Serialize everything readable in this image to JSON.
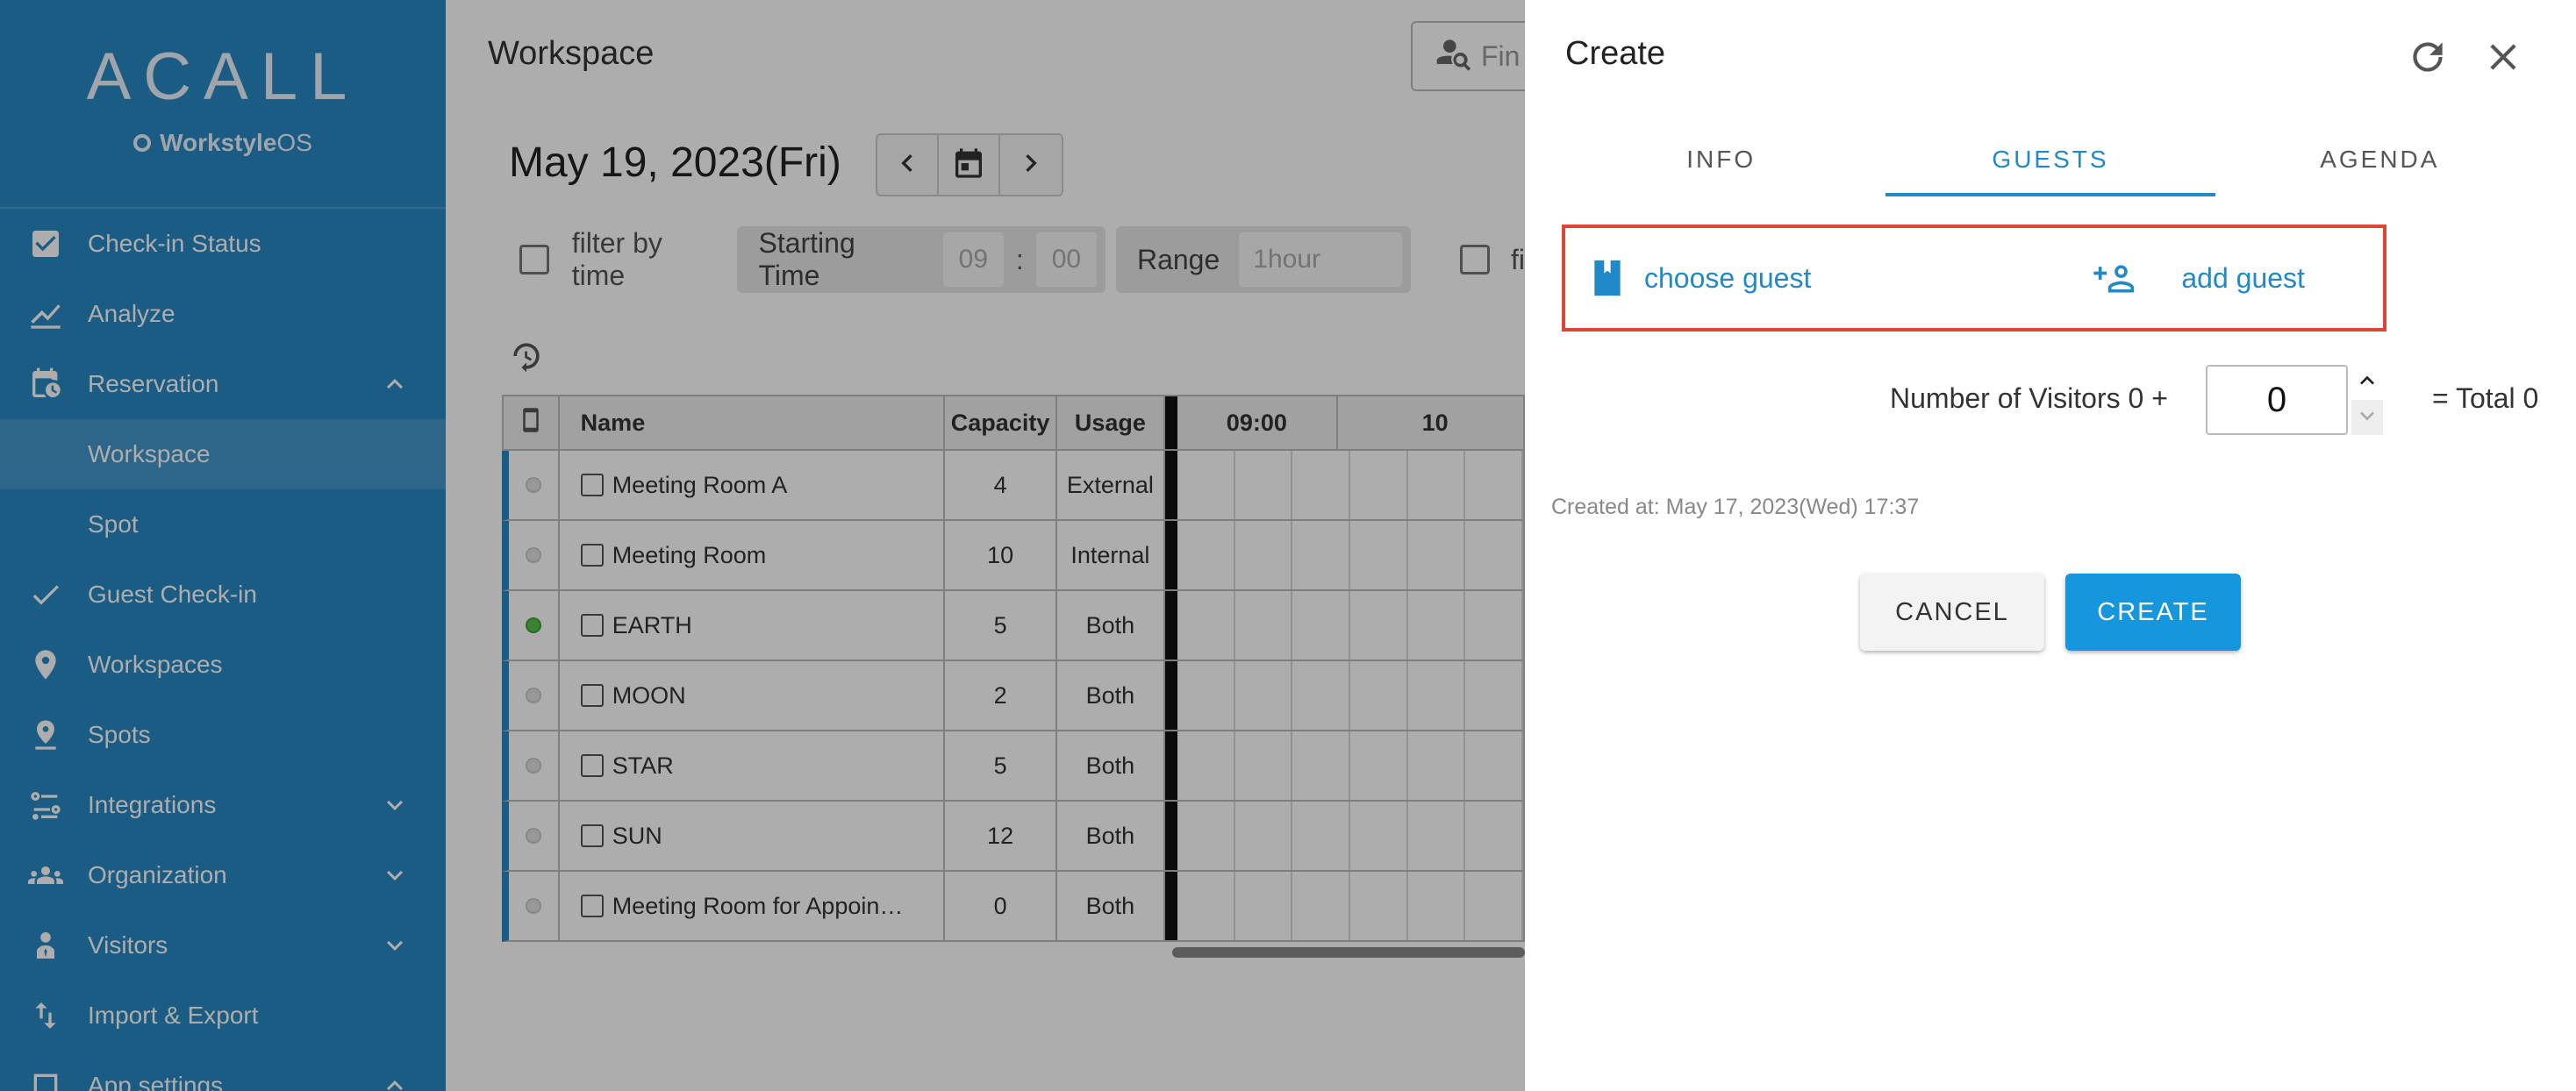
{
  "sidebar": {
    "logo": "ACALL",
    "product_prefix": "Workstyle",
    "product_suffix": "OS",
    "items": [
      {
        "label": "Check-in Status",
        "icon": "checkbox-icon"
      },
      {
        "label": "Analyze",
        "icon": "chart-line-icon"
      },
      {
        "label": "Reservation",
        "icon": "calendar-clock-icon",
        "expanded": true
      },
      {
        "label": "Workspace",
        "selected": true
      },
      {
        "label": "Spot"
      },
      {
        "label": "Guest Check-in",
        "icon": "check-icon"
      },
      {
        "label": "Workspaces",
        "icon": "location-pin-icon"
      },
      {
        "label": "Spots",
        "icon": "map-pin-icon"
      },
      {
        "label": "Integrations",
        "icon": "integrations-icon",
        "expandable": true
      },
      {
        "label": "Organization",
        "icon": "people-icon",
        "expandable": true
      },
      {
        "label": "Visitors",
        "icon": "visitor-icon",
        "expandable": true
      },
      {
        "label": "Import & Export",
        "icon": "import-export-icon"
      },
      {
        "label": "App settings",
        "icon": "app-settings-icon",
        "expanded": true
      }
    ]
  },
  "main": {
    "title": "Workspace",
    "finder_placeholder": "Fin",
    "date": "May 19, 2023(Fri)",
    "filter": {
      "filter_by_time": "filter by time",
      "starting_time_label": "Starting Time",
      "hour": "09",
      "separator": ":",
      "minute": "00",
      "range_label": "Range",
      "range_value": "1hour",
      "trailing": "fi"
    },
    "table": {
      "headers": {
        "name": "Name",
        "capacity": "Capacity",
        "usage": "Usage",
        "time1": "09:00",
        "time2": "10"
      },
      "rows": [
        {
          "name": "Meeting Room A",
          "capacity": "4",
          "usage": "External",
          "status": "gray"
        },
        {
          "name": "Meeting Room",
          "capacity": "10",
          "usage": "Internal",
          "status": "gray"
        },
        {
          "name": "EARTH",
          "capacity": "5",
          "usage": "Both",
          "status": "green"
        },
        {
          "name": "MOON",
          "capacity": "2",
          "usage": "Both",
          "status": "gray"
        },
        {
          "name": "STAR",
          "capacity": "5",
          "usage": "Both",
          "status": "gray"
        },
        {
          "name": "SUN",
          "capacity": "12",
          "usage": "Both",
          "status": "gray"
        },
        {
          "name": "Meeting Room for Appoin…",
          "capacity": "0",
          "usage": "Both",
          "status": "gray"
        }
      ]
    }
  },
  "dialog": {
    "title": "Create",
    "tabs": [
      {
        "label": "INFO",
        "active": false
      },
      {
        "label": "GUESTS",
        "active": true
      },
      {
        "label": "AGENDA",
        "active": false
      }
    ],
    "choose_guest": "choose guest",
    "add_guest": "add guest",
    "visitors_label": "Number of Visitors 0 +",
    "visitors_value": "0",
    "total": "= Total 0",
    "created_at": "Created at: May 17, 2023(Wed) 17:37",
    "cancel": "CANCEL",
    "create": "CREATE"
  },
  "colors": {
    "sidebar": "#2888c3",
    "accent": "#2189c8",
    "create_button": "#1596dd",
    "highlight_box": "#e04434"
  }
}
